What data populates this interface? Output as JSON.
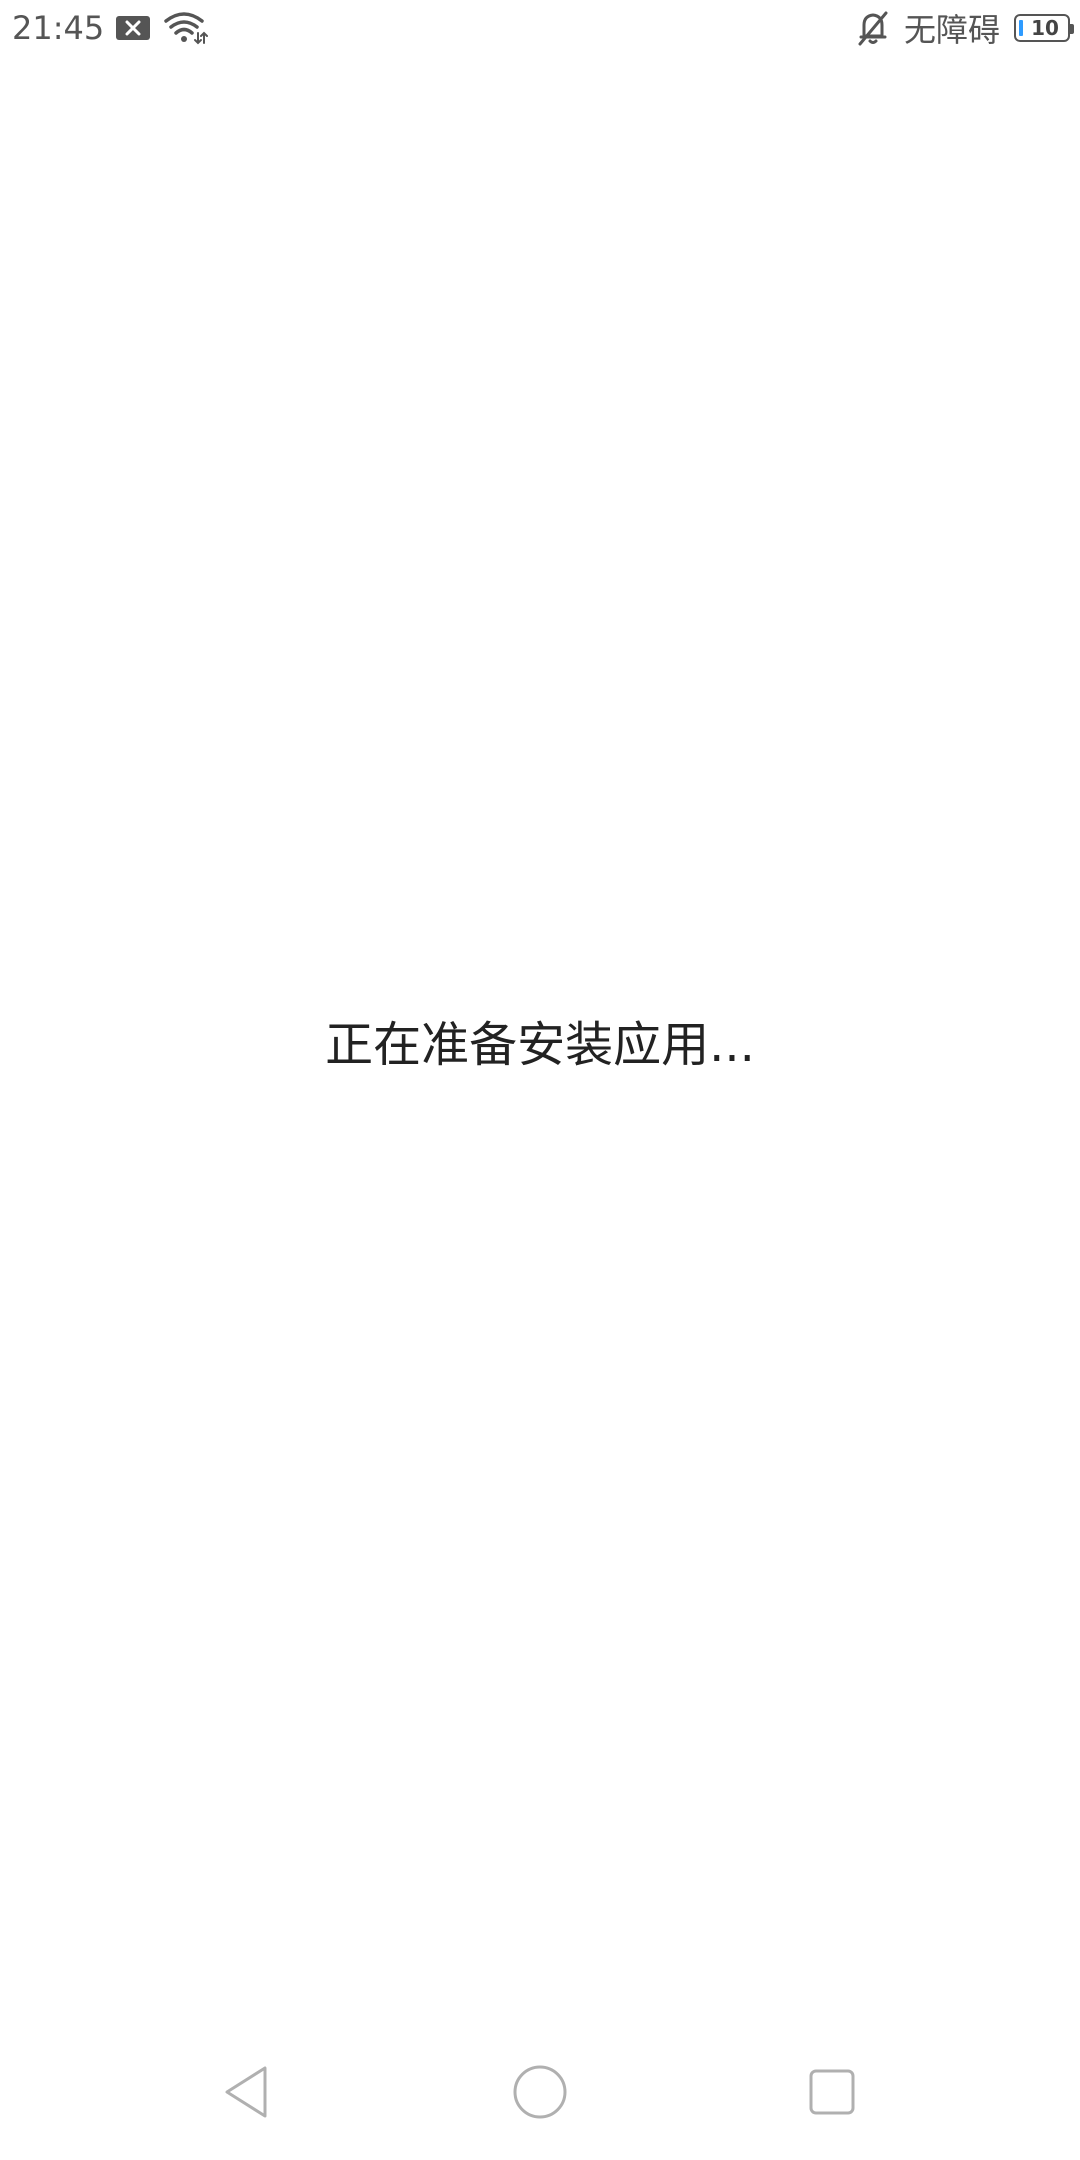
{
  "status_bar": {
    "time": "21:45",
    "left_icons": [
      "close-notification-icon",
      "wifi-icon"
    ],
    "ring_mode_icon": "bell-off-icon",
    "accessibility_text": "无障碍",
    "battery_level": "10",
    "battery_color": "#2e9bff"
  },
  "main": {
    "message": "正在准备安装应用..."
  },
  "nav_bar": {
    "buttons": [
      "back-icon",
      "home-icon",
      "recent-apps-icon"
    ]
  }
}
